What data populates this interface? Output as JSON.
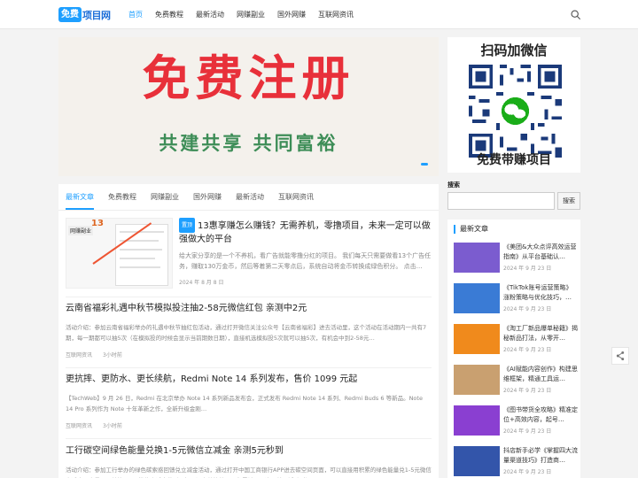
{
  "header": {
    "logo_mark": "免费",
    "logo_text": "项目网",
    "nav": [
      "首页",
      "免费教程",
      "最新活动",
      "网赚副业",
      "国外网赚",
      "互联网资讯"
    ]
  },
  "banner": {
    "headline": "免费注册",
    "slogan": "共建共享  共同富裕"
  },
  "qr_panel": {
    "title": "扫码加微信",
    "bottom": "免费带赚项目"
  },
  "tabs": [
    "最新文章",
    "免费教程",
    "网赚副业",
    "国外网赚",
    "最新活动",
    "互联网资讯"
  ],
  "posts": [
    {
      "badge": "置顶",
      "title": "13惠享赚怎么赚钱？无需养机，零撸项目，未来一定可以做强做大的平台",
      "excerpt": "给大家分享的是一个不养机，看广告就能零撸分红的项目。 我们每天只需要做看13个广告任务，赚取130万金币，然后等着第二天零点后，系统自动将金币转换成绿色积分。 点击…",
      "date": "2024 年 8 月 8 日",
      "thumb_tag": "网赚副业",
      "thumb_num": "13"
    },
    {
      "title": "云南省福彩礼遇中秋节模拟投注抽2-58元微信红包 亲测中2元",
      "excerpt": "活动介绍：参加云南省福彩举办的礼遇中秋节抽红包活动，通过打开微信关注公众号【云南省福彩】进去活动里，这个活动在活动期内一共有7期，每一期都可以抽5次（在模拟投的时候会显示当前期数日期），直接机选模拟投5次就可以抽5次，有机会中到2-58元…",
      "category": "互联网资讯",
      "time": "3小时前"
    },
    {
      "title": "更抗摔、更防水、更长续航，Redmi Note 14 系列发布，售价 1099 元起",
      "excerpt": "【TechWeb】9 月 26 日，Redmi 在北京举办 Note 14 系列新品发布会，正式发布 Redmi Note 14 系列、Redmi Buds 6 等新品。Note 14 Pro 系列作为 Note 十年革新之作，全新升级金刚…",
      "category": "互联网资讯",
      "time": "3小时前"
    },
    {
      "title": "工行碳空间绿色能量兑换1-5元微信立减金 亲测5元秒到",
      "excerpt": "活动介绍：参加工行举办的绿色碳索惑回馈兑立减金活动，通过打开中国工商银行APP进去碳空间页面，可以直接用积累的绿色能量兑1-5元微信立减金，少量可以兑换了5元微信立减金秒到，如果没有兑换的可以积累够了一次再兑，活动时间：202…",
      "category": "互联网资讯",
      "time": "3小时前"
    }
  ],
  "sidebar": {
    "search_label": "搜索",
    "search_button": "搜索",
    "latest_title": "最新文章",
    "latest": [
      {
        "title": "《美团&大众点评高效运营指南》从平台基础认…",
        "date": "2024 年 9 月 23 日",
        "color": "#7b5ccf"
      },
      {
        "title": "《TikTok账号运营策略》涨粉策略与优化技巧，…",
        "date": "2024 年 9 月 23 日",
        "color": "#3a7bd5"
      },
      {
        "title": "《淘工厂新品爆单秘籍》揭秘新品打法，从零开…",
        "date": "2024 年 9 月 23 日",
        "color": "#f08a1c"
      },
      {
        "title": "《AI赋能内容创作》构建思维框架，精通工具运…",
        "date": "2024 年 9 月 23 日",
        "color": "#c9a070"
      },
      {
        "title": "《图书带货全攻略》精准定位+高效内容，起号…",
        "date": "2024 年 9 月 23 日",
        "color": "#8a3fd1"
      },
      {
        "title": "抖店新手必学《掌握四大流量渠道技巧》打造商…",
        "date": "2024 年 9 月 23 日",
        "color": "#3355aa"
      }
    ]
  }
}
